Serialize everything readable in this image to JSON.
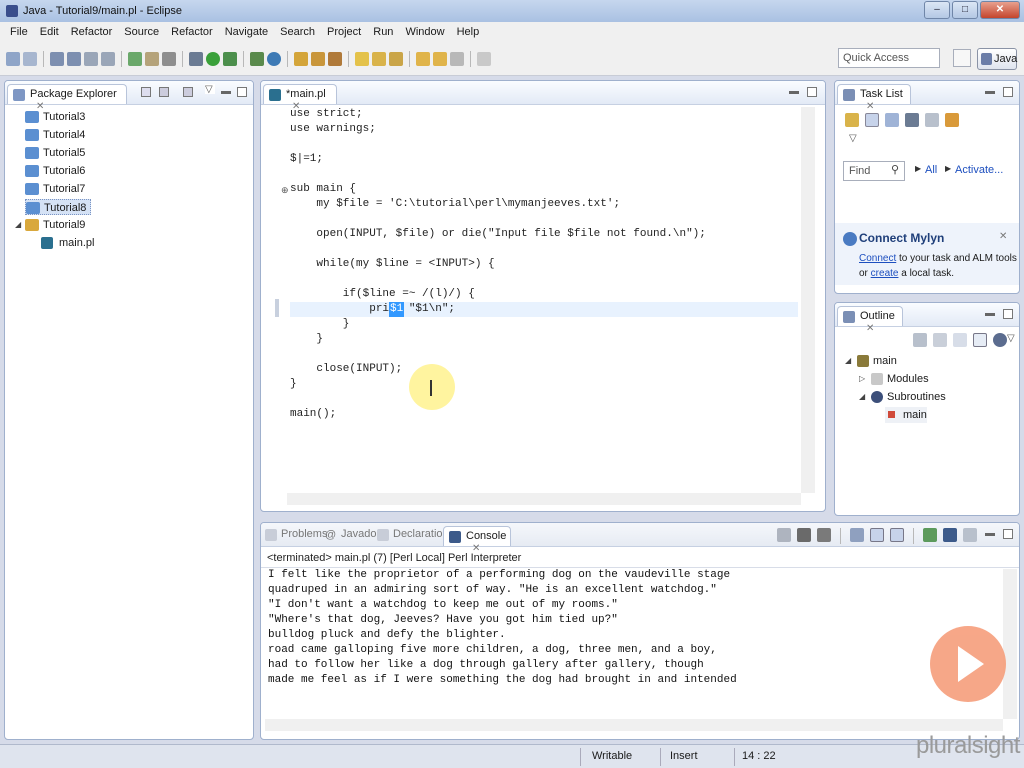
{
  "window": {
    "title": "Java - Tutorial9/main.pl - Eclipse"
  },
  "menu": [
    "File",
    "Edit",
    "Refactor",
    "Source",
    "Refactor",
    "Navigate",
    "Search",
    "Project",
    "Run",
    "Window",
    "Help"
  ],
  "toolbar": {
    "quick_access_placeholder": "Quick Access",
    "perspective_label": "Java"
  },
  "package_explorer": {
    "tab_label": "Package Explorer",
    "items": [
      {
        "label": "Tutorial3"
      },
      {
        "label": "Tutorial4"
      },
      {
        "label": "Tutorial5"
      },
      {
        "label": "Tutorial6"
      },
      {
        "label": "Tutorial7"
      },
      {
        "label": "Tutorial8"
      },
      {
        "label": "Tutorial9"
      },
      {
        "label": "main.pl"
      }
    ]
  },
  "editor": {
    "tab_label": "*main.pl",
    "lines": [
      "use strict;",
      "use warnings;",
      "$|=1;",
      "sub main {",
      "    my $file = 'C:\\tutorial\\perl\\mymanjeeves.txt';",
      "    open(INPUT, $file) or die(\"Input file $file not found.\\n\");",
      "    while(my $line = <INPUT>) {",
      "        if($line =~ /(l)/) {",
      "            print \"$1\\n\";",
      "        }",
      "    }",
      "    close(INPUT);",
      "}",
      "main();"
    ],
    "selected_text": "$1"
  },
  "task_list": {
    "tab_label": "Task List",
    "find_placeholder": "Find",
    "all_label": "All",
    "activate_label": "Activate..."
  },
  "connect_mylyn": {
    "title": "Connect Mylyn",
    "connect_link": "Connect",
    "text1": " to your task and ALM tools",
    "or": "or ",
    "create_link": "create",
    "text2": " a local task."
  },
  "outline": {
    "tab_label": "Outline",
    "items": [
      {
        "label": "main"
      },
      {
        "label": "Modules"
      },
      {
        "label": "Subroutines"
      },
      {
        "label": "main"
      }
    ]
  },
  "bottom_tabs": [
    "Problems",
    "Javadoc",
    "Declaration",
    "Console"
  ],
  "console": {
    "header": "<terminated> main.pl (7) [Perl Local] Perl Interpreter",
    "lines": [
      "I felt like the proprietor of a performing dog on the vaudeville stage",
      "quadruped in an admiring sort of way. \"He is an excellent watchdog.\"",
      "\"I don't want a watchdog to keep me out of my rooms.\"",
      "\"Where's that dog, Jeeves? Have you got him tied up?\"",
      "bulldog pluck and defy the blighter.",
      "road came galloping five more children, a dog, three men, and a boy,",
      "had to follow her like a dog through gallery after gallery, though",
      "made me feel as if I were something the dog had brought in and intended"
    ]
  },
  "status": {
    "writable": "Writable",
    "insert": "Insert",
    "position": "14 : 22"
  },
  "watermark": {
    "logo_text": "pluralsight"
  },
  "colors": {
    "accent": "#3399ff",
    "keyword": "#7f0055",
    "string": "#2a00ff",
    "panel_border": "#9fb0cd"
  }
}
